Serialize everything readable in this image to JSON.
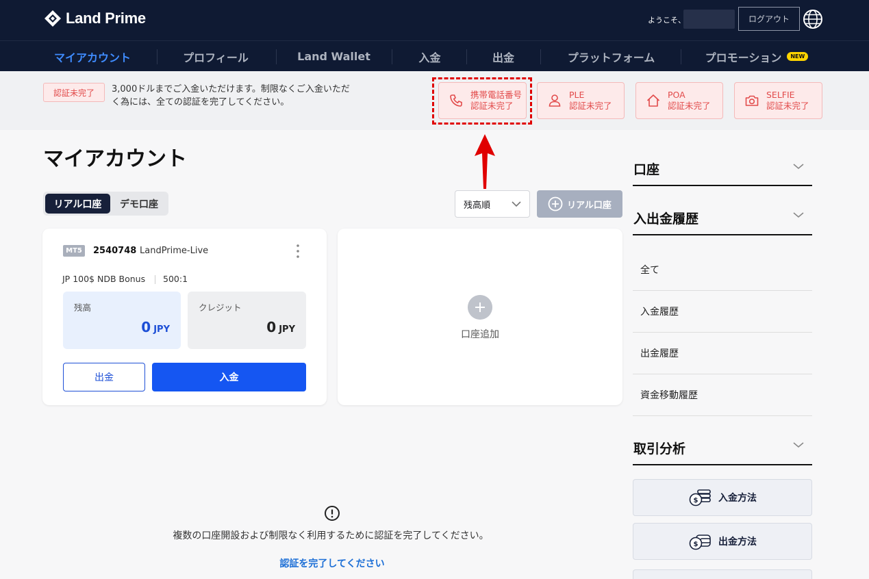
{
  "header": {
    "brand": "Land Prime",
    "welcome": "ようこそ、",
    "logout_label": "ログアウト"
  },
  "nav": {
    "items": [
      {
        "label": "マイアカウント",
        "active": true
      },
      {
        "label": "プロフィール"
      },
      {
        "label": "Land Wallet"
      },
      {
        "label": "入金"
      },
      {
        "label": "出金"
      },
      {
        "label": "プラットフォーム"
      },
      {
        "label": "プロモーション"
      }
    ],
    "new_badge": "NEW"
  },
  "verification": {
    "status_badge": "認証未完了",
    "message": "3,000ドルまでご入金いただけます。制限なくご入金いただく為には、全ての認証を完了してください。",
    "buttons": [
      {
        "title": "携帯電話番号",
        "status": "認証未完了",
        "icon": "phone-icon"
      },
      {
        "title": "PLE",
        "status": "認証未完了",
        "icon": "user-icon"
      },
      {
        "title": "POA",
        "status": "認証未完了",
        "icon": "home-icon"
      },
      {
        "title": "SELFIE",
        "status": "認証未完了",
        "icon": "camera-icon"
      }
    ]
  },
  "main": {
    "title": "マイアカウント",
    "tabs": [
      {
        "label": "リアル口座",
        "active": true
      },
      {
        "label": "デモ口座"
      }
    ],
    "sort_label": "残高順",
    "add_real_label": "リアル口座",
    "account": {
      "platform": "MT5",
      "number": "2540748",
      "server": "LandPrime-Live",
      "type": "JP 100$ NDB Bonus",
      "leverage": "500:1",
      "balance_label": "残高",
      "balance_value": "0",
      "balance_currency": "JPY",
      "credit_label": "クレジット",
      "credit_value": "0",
      "credit_currency": "JPY",
      "withdraw_label": "出金",
      "deposit_label": "入金"
    },
    "add_account_label": "口座追加",
    "warning_message": "複数の口座開設および制限なく利用するために認証を完了してください。",
    "verify_link": "認証を完了してください"
  },
  "sidebar": {
    "accounts_heading": "口座",
    "history_heading": "入出金履歴",
    "history_items": [
      "全て",
      "入金履歴",
      "出金履歴",
      "資金移動履歴"
    ],
    "analysis_heading": "取引分析",
    "cards": [
      {
        "label": "入金方法",
        "icon": "deposit-coins-icon"
      },
      {
        "label": "出金方法",
        "icon": "withdraw-wallet-icon"
      }
    ]
  },
  "colors": {
    "header_bg": "#0f1a33",
    "accent_blue": "#1556f2",
    "nav_active": "#3f8cff",
    "warning_red": "#e24a4a",
    "annotation_red": "#e00000"
  }
}
